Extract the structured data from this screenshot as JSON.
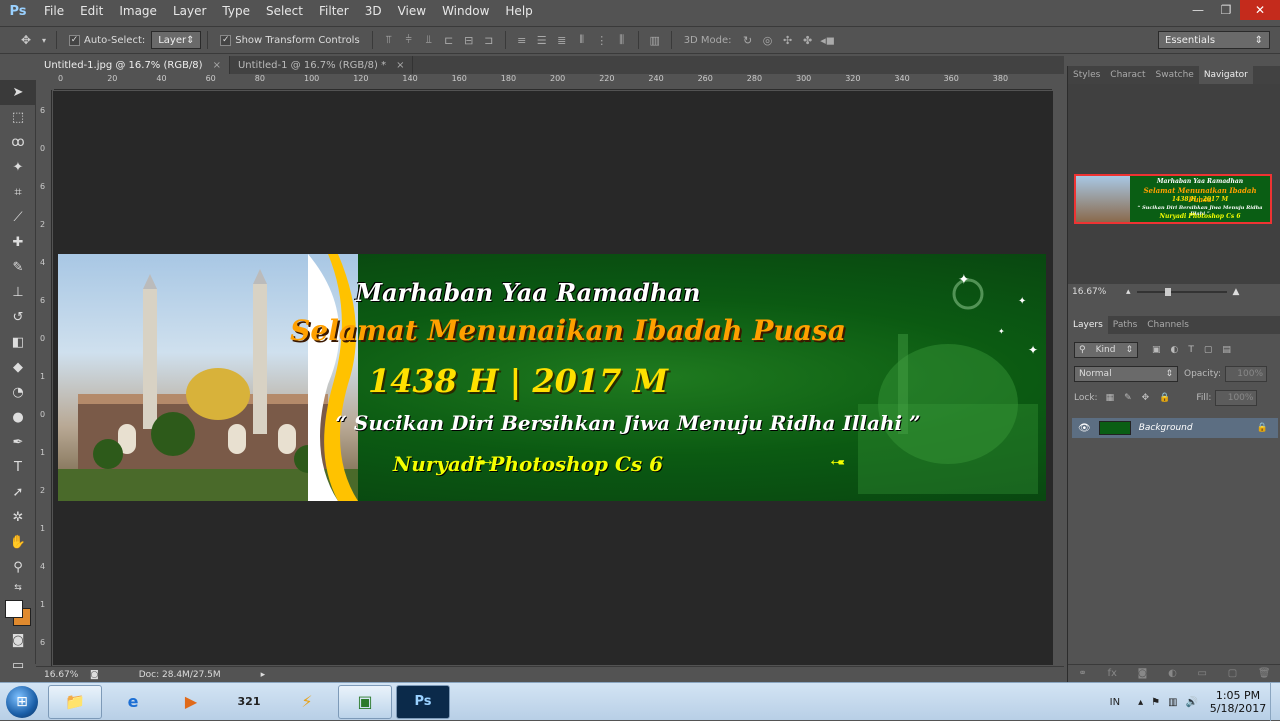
{
  "app": {
    "logo": "Ps",
    "colors": {
      "accent": "#9ad1ff",
      "close": "#c42b1c"
    }
  },
  "menu": [
    "File",
    "Edit",
    "Image",
    "Layer",
    "Type",
    "Select",
    "Filter",
    "3D",
    "View",
    "Window",
    "Help"
  ],
  "window_controls": {
    "minimize": "—",
    "maximize": "❐",
    "close": "✕"
  },
  "options": {
    "auto_select_label": "Auto-Select:",
    "auto_select_value": "Layer",
    "transform_label": "Show Transform Controls",
    "mode_label": "3D Mode:",
    "workspace": "Essentials"
  },
  "tabs": [
    {
      "label": "Untitled-1.jpg @ 16.7% (RGB/8)",
      "close": "×",
      "active": true
    },
    {
      "label": "Untitled-1 @ 16.7% (RGB/8) *",
      "close": "×",
      "active": false
    }
  ],
  "ruler_h": [
    "0",
    "20",
    "40",
    "60",
    "80",
    "100",
    "120",
    "140",
    "160",
    "180",
    "200",
    "220",
    "240",
    "260",
    "280",
    "300",
    "320",
    "340",
    "360",
    "380"
  ],
  "ruler_v": [
    "6",
    "0",
    "6",
    "2",
    "4",
    "6",
    "0",
    "1",
    "0",
    "1",
    "2",
    "1",
    "4",
    "1",
    "6"
  ],
  "banner": {
    "line1": "Marhaban Yaa Ramadhan",
    "line2": "Selamat Menunaikan Ibadah Puasa",
    "line3": "1438 H | 2017 M",
    "line4": "“ Sucikan Diri Bersihkan Jiwa Menuju Ridha Illahi ”",
    "line5": "Nuryadi Photoshop Cs 6"
  },
  "status": {
    "zoom": "16.67%",
    "doc": "Doc: 28.4M/27.5M"
  },
  "panels": {
    "top_tabs": [
      "Styles",
      "Charact",
      "Swatche",
      "Navigator"
    ],
    "nav_zoom": "16.67%",
    "layer_tabs": [
      "Layers",
      "Paths",
      "Channels"
    ],
    "kind": "Kind",
    "blend": "Normal",
    "opacity_label": "Opacity:",
    "opacity": "100%",
    "lock_label": "Lock:",
    "fill_label": "Fill:",
    "fill": "100%",
    "layer_name": "Background"
  },
  "taskbar": {
    "lang": "IN",
    "time": "1:05 PM",
    "date": "5/18/2017"
  }
}
